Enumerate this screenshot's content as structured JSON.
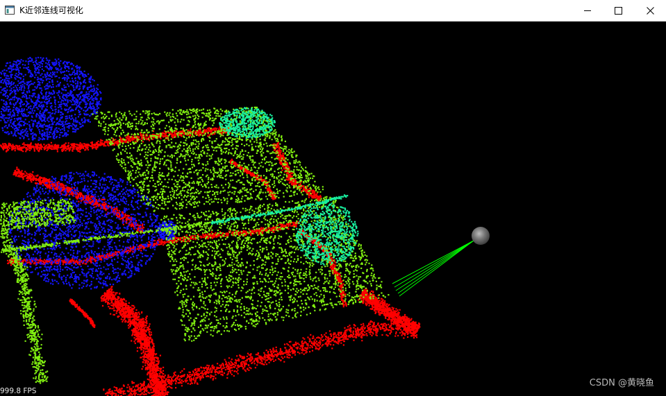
{
  "window": {
    "title": "K近邻连线可视化",
    "icon": "app-window-icon",
    "controls": [
      "minimize-icon",
      "maximize-icon",
      "close-icon"
    ]
  },
  "viewport": {
    "background_color": "#000000",
    "fps_text": "999.8 FPS",
    "watermark": "CSDN @黄晓鱼",
    "point_colors": {
      "red": "#ff0000",
      "green": "#80ee10",
      "blue": "#1414ff",
      "cyan": "#18f0a0"
    },
    "line_color": "#00ff00",
    "sphere_color": "#6e6e6e"
  }
}
